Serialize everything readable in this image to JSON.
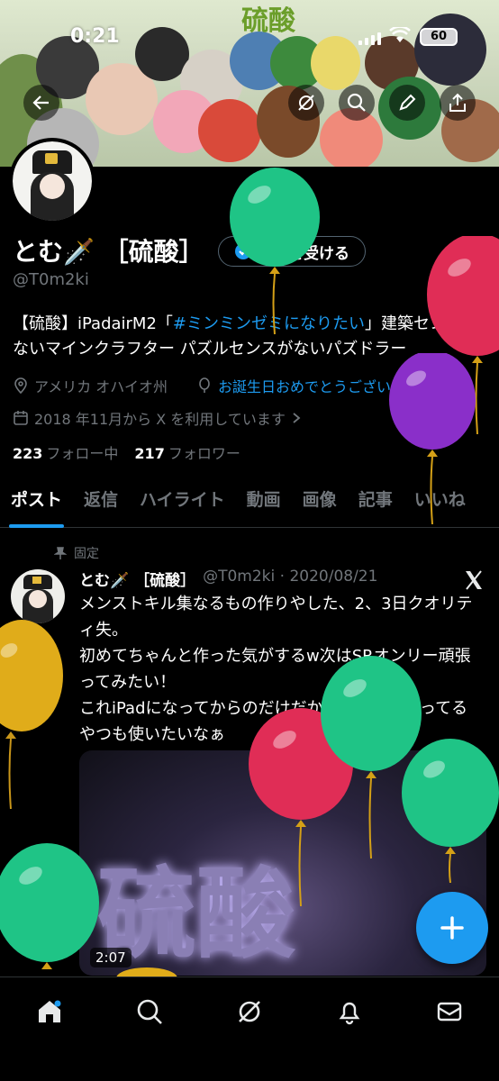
{
  "status": {
    "time": "0:21",
    "battery": "60"
  },
  "banner": {
    "title": "硫酸"
  },
  "profile": {
    "name": "とむ🗡️ ［硫酸］",
    "verify_label": "認証を受ける",
    "handle": "@T0m2ki",
    "bio_prefix": "【硫酸】iPadairM2「",
    "bio_hashtag": "#ミンミンゼミになりたい",
    "bio_suffix": "」建築センスがないマインクラフター パズルセンスがないパズドラー",
    "location": "アメリカ オハイオ州",
    "birthday_text": "お誕生日おめでとうございます。",
    "joined": "2018 年11月から X を利用しています",
    "following_count": "223",
    "following_label": "フォロー中",
    "followers_count": "217",
    "followers_label": "フォロワー"
  },
  "tabs": [
    {
      "label": "ポスト"
    },
    {
      "label": "返信"
    },
    {
      "label": "ハイライト"
    },
    {
      "label": "動画"
    },
    {
      "label": "画像"
    },
    {
      "label": "記事"
    },
    {
      "label": "いいね"
    }
  ],
  "tweet": {
    "pinned_label": "固定",
    "author": "とむ🗡️ ［硫酸］",
    "handle_date": "@T0m2ki · 2020/08/21",
    "text_lines": [
      "メンストキル集なるもの作りやした、2、3日クオリティ失。",
      "初めてちゃんと作った気がするw次はSRオンリー頑張ってみたい！",
      "これiPadになってからのだけだからスマホに入ってるやつも使いたいなぁ"
    ],
    "media_kanji": "硫酸",
    "duration": "2:07"
  },
  "colors": {
    "accent": "#1d9bf0",
    "background": "#000000",
    "muted": "#71767b"
  }
}
